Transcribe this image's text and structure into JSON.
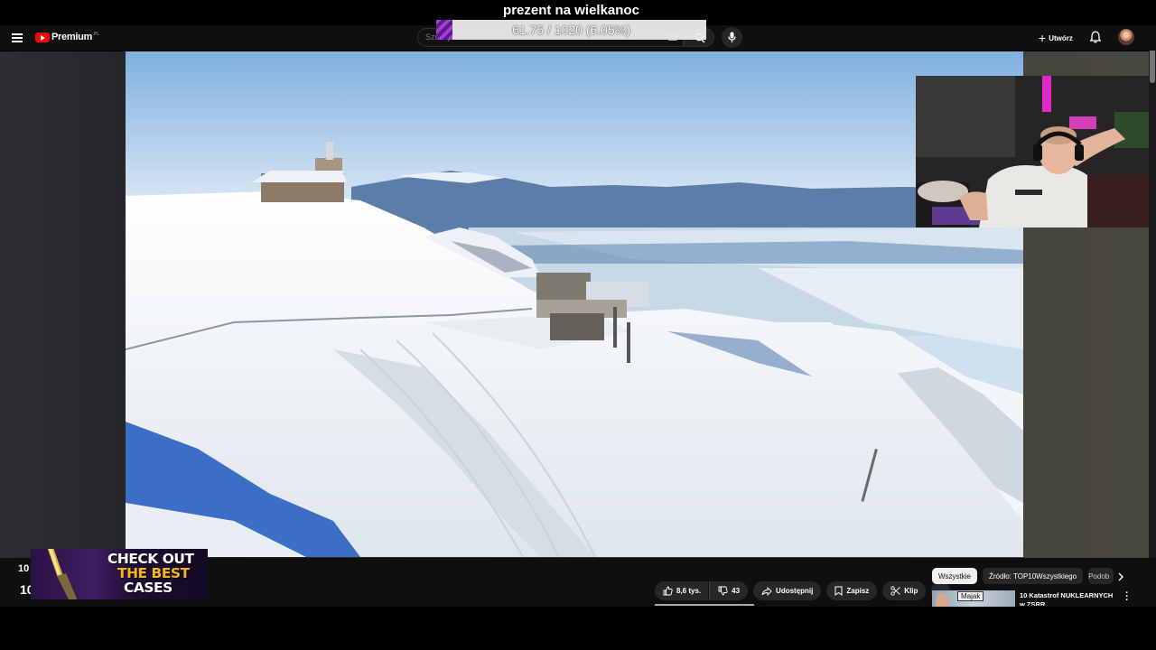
{
  "overlay": {
    "donation_title": "prezent na wielkanoc",
    "goal_text": "61.75 / 1020 (6.05%)",
    "goal_progress": 0.0605,
    "goal_color": "#8a2fc4"
  },
  "topbar": {
    "menu_icon": "hamburger-icon",
    "logo_text": "Premium",
    "logo_country": "PL",
    "search_placeholder": "Szukaj",
    "search_icon": "search-icon",
    "mic_icon": "microphone-icon",
    "create_label": "Utwórz",
    "create_icon": "plus-icon",
    "notifications_icon": "bell-icon",
    "brand_color": "#ff0000"
  },
  "below": {
    "left_number": "10",
    "left_number2": "10",
    "ad": {
      "line1": "CHECK OUT",
      "line2": "THE BEST",
      "line3": "CASES",
      "accent": "#f6b519"
    },
    "actions": {
      "like": "8,6 tys.",
      "dislike": "43",
      "share": "Udostępnij",
      "save": "Zapisz",
      "clip": "Klip",
      "more": "⋯"
    },
    "chips": [
      "Wszystkie",
      "Źródło: TOP10Wszystkiego",
      "Podob"
    ],
    "recommendation": {
      "thumb_badge": "Majak",
      "title": "10 Katastrof NUKLEARNYCH w ZSRR"
    }
  }
}
